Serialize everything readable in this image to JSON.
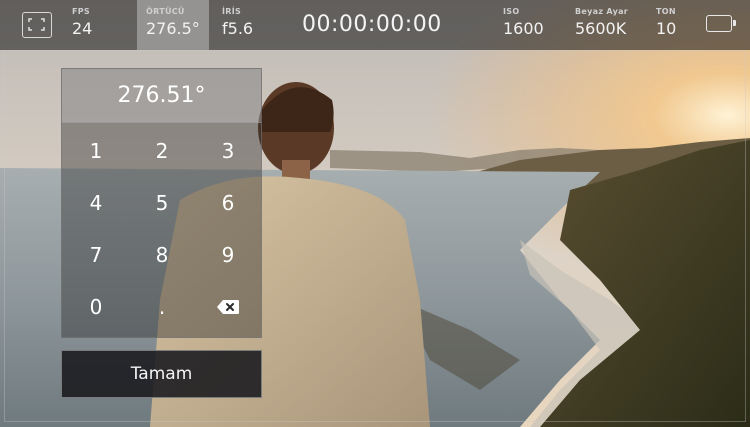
{
  "camera": {
    "fps": {
      "label": "FPS",
      "value": "24"
    },
    "shutter": {
      "label": "ÖRTÜCÜ",
      "value": "276.5°"
    },
    "iris": {
      "label": "İRİS",
      "value": "f5.6"
    },
    "timecode": "00:00:00:00",
    "iso": {
      "label": "ISO",
      "value": "1600"
    },
    "white_balance": {
      "label": "Beyaz Ayar",
      "value": "5600K"
    },
    "tint": {
      "label": "TON",
      "value": "10"
    }
  },
  "keypad": {
    "display": "276.51°",
    "keys": [
      "1",
      "2",
      "3",
      "4",
      "5",
      "6",
      "7",
      "8",
      "9",
      "0",
      "."
    ],
    "done_label": "Tamam"
  },
  "colors": {
    "sky_top": "#cfc9c2",
    "sky_glow": "#f6c27a",
    "sea": "#8d969a",
    "cliff": "#3b3a22",
    "active_tab": "#9a9a9a"
  },
  "icons": {
    "fit": "frame-fit-icon",
    "backspace": "backspace-icon",
    "battery": "battery-icon"
  }
}
